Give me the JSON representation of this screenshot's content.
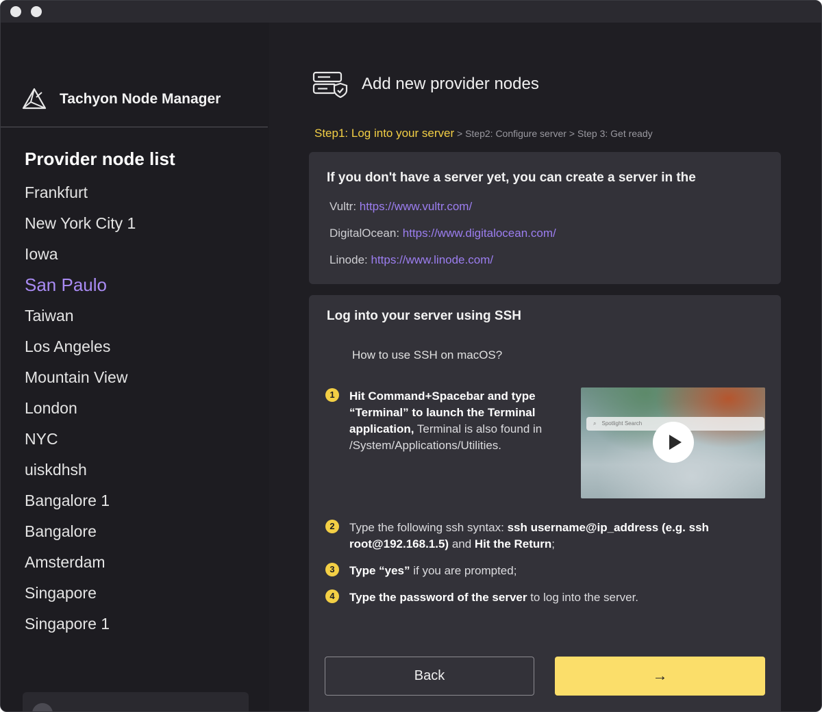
{
  "window": {
    "brand_name": "Tachyon Node Manager"
  },
  "sidebar": {
    "list_title": "Provider node list",
    "active_index": 3,
    "nodes": [
      "Frankfurt",
      "New York City 1",
      "Iowa",
      "San Paulo",
      "Taiwan",
      "Los Angeles",
      "Mountain View",
      "London",
      "NYC",
      "uiskdhsh",
      "Bangalore 1",
      "Bangalore",
      "Amsterdam",
      "Singapore",
      "Singapore 1"
    ]
  },
  "main": {
    "title": "Add new provider nodes",
    "breadcrumb": {
      "step1": "Step1: Log into your server",
      "rest": " > Step2: Configure server > Step 3: Get ready"
    },
    "create_card": {
      "title": "If you don't have a server yet, you can create a server in the",
      "providers": [
        {
          "name": "Vultr: ",
          "url": "https://www.vultr.com/"
        },
        {
          "name": "DigitalOcean: ",
          "url": "https://www.digitalocean.com/"
        },
        {
          "name": "Linode: ",
          "url": "https://www.linode.com/"
        }
      ]
    },
    "ssh_card": {
      "title": "Log into your server using SSH",
      "howto": "How to use SSH on macOS?",
      "steps": [
        {
          "num": "1",
          "bold": "Hit Command+Spacebar and type “Terminal” to launch the Terminal application,",
          "text": " Terminal is also found in /System/Applications/Utilities."
        },
        {
          "num": "2",
          "pre": "Type the following ssh syntax: ",
          "bold": "ssh username@ip_address (e.g. ssh root@192.168.1.5)",
          "mid": " and ",
          "bold2": "Hit the Return",
          "post": ";"
        },
        {
          "num": "3",
          "bold": "Type “yes”",
          "text": " if you are prompted;"
        },
        {
          "num": "4",
          "bold": "Type the password of the server",
          "text": " to log into the server."
        }
      ],
      "video": {
        "spotlight_placeholder": "Spotlight Search"
      }
    },
    "buttons": {
      "back": "Back",
      "next": "→"
    }
  },
  "icons": {
    "brand": "triangle-logo-icon",
    "server": "server-shield-icon",
    "play": "play-icon",
    "search": "search-icon"
  },
  "colors": {
    "accent_yellow": "#f3cf45",
    "button_yellow": "#fbde6a",
    "link_purple": "#9c7ef0",
    "active_purple": "#a98bf3",
    "background": "#1f1e23",
    "card": "#333239"
  }
}
